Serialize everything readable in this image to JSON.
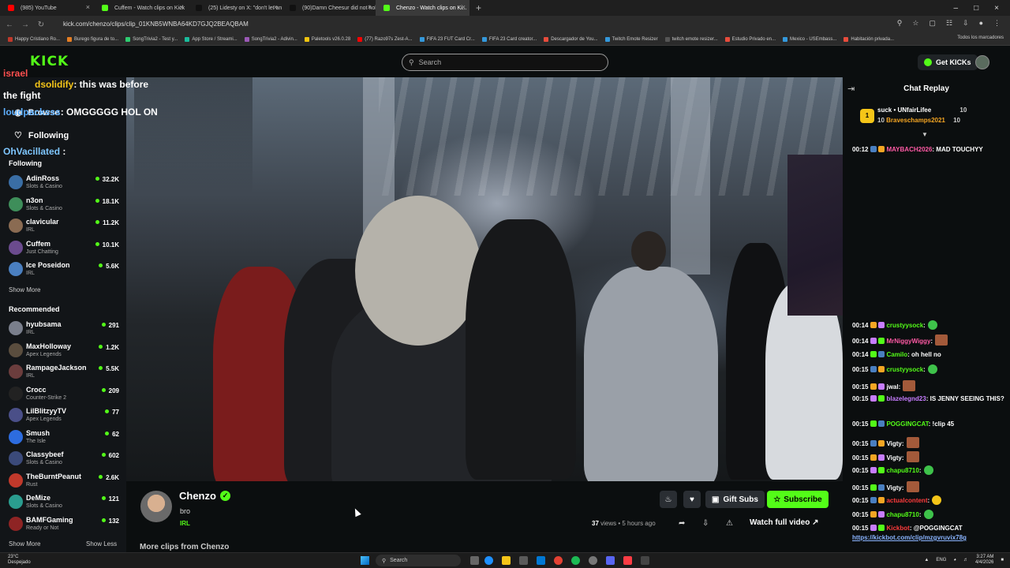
{
  "browser": {
    "tabs": [
      {
        "label": "(985) YouTube",
        "color": "#ff0000"
      },
      {
        "label": "Cuffem - Watch clips on Kick",
        "color": "#53fc18"
      },
      {
        "label": "(25) Lidesty on X: \"don't let any...",
        "color": "#111111"
      },
      {
        "label": "(90)Damn Cheesur did not hold...",
        "color": "#111111"
      },
      {
        "label": "Chenzo - Watch clips on Ki...",
        "color": "#53fc18",
        "active": true
      }
    ],
    "url": "kick.com/chenzo/clips/clip_01KNB5WNBA64KD7GJQ2BEAQBAM",
    "bookmarks": [
      "Happy Cristiano Ro...",
      "Burego figura de to...",
      "SongTrivia2 - Test y...",
      "App Store / Streami...",
      "SongTrivia2 - Adivin...",
      "Paletools v26.0.28",
      "(77) Razo97s Zest-A...",
      "FIFA 23 FUT Card Cr...",
      "FIFA 23 Card creator...",
      "Descargador de You...",
      "Twitch Emote Resizer",
      "twitch emote resizer...",
      "Estudio Privado en...",
      "Mexico - USEmbass...",
      "Habitación privada..."
    ],
    "bookmarks_right": "Todos los marcadores"
  },
  "site": {
    "logo": "KICK",
    "search_placeholder": "Search",
    "get_kicks": "Get KICKs"
  },
  "overlay_chat": [
    {
      "user": "israel",
      "text": ""
    },
    {
      "user": "dsolidify",
      "text": ": this was before"
    },
    {
      "user": "",
      "text": "the fight"
    },
    {
      "user": "loudpacksss",
      "text": ": OMGGGGG HOL ON"
    },
    {
      "user": "OhVacillated",
      "text": " :"
    }
  ],
  "sidebar": {
    "nav": [
      {
        "label": "Browse",
        "icon": "browse-icon"
      },
      {
        "label": "Following",
        "icon": "heart-icon"
      }
    ],
    "following_title": "Following",
    "following": [
      {
        "name": "AdinRoss",
        "category": "Slots & Casino",
        "viewers": "32.2K",
        "color": "#3a6ea5"
      },
      {
        "name": "n3on",
        "category": "Slots & Casino",
        "viewers": "18.1K",
        "color": "#3e8e5a"
      },
      {
        "name": "clavicular",
        "category": "IRL",
        "viewers": "11.2K",
        "color": "#8a6b52"
      },
      {
        "name": "Cuffem",
        "category": "Just Chatting",
        "viewers": "10.1K",
        "color": "#6b4b8e"
      },
      {
        "name": "Ice Poseidon",
        "category": "IRL",
        "viewers": "5.6K",
        "color": "#4a7fc0"
      }
    ],
    "show_more": "Show More",
    "recommended_title": "Recommended",
    "recommended": [
      {
        "name": "hyubsama",
        "category": "IRL",
        "viewers": "291",
        "color": "#7a7f8c"
      },
      {
        "name": "MaxHolloway",
        "category": "Apex Legends",
        "viewers": "1.2K",
        "color": "#5a4d3e"
      },
      {
        "name": "RampageJackson",
        "category": "IRL",
        "viewers": "5.5K",
        "color": "#6b3d3d"
      },
      {
        "name": "Crocc",
        "category": "Counter-Strike 2",
        "viewers": "209",
        "color": "#222222"
      },
      {
        "name": "LilBlitzyyTV",
        "category": "Apex Legends",
        "viewers": "77",
        "color": "#4a4f88"
      },
      {
        "name": "Smush",
        "category": "The Isle",
        "viewers": "62",
        "color": "#2d6cdf"
      },
      {
        "name": "Classybeef",
        "category": "Slots & Casino",
        "viewers": "602",
        "color": "#3b4a7a"
      },
      {
        "name": "TheBurntPeanut",
        "category": "Rust",
        "viewers": "2.6K",
        "color": "#c0392b"
      },
      {
        "name": "DeMize",
        "category": "Slots & Casino",
        "viewers": "121",
        "color": "#2a9d8f"
      },
      {
        "name": "BAMFGaming",
        "category": "Ready or Not",
        "viewers": "132",
        "color": "#8e2424"
      }
    ],
    "show_more_2": "Show More",
    "show_less": "Show Less"
  },
  "channel": {
    "name": "Chenzo",
    "title": "bro",
    "category": "IRL",
    "gift_subs": "Gift Subs",
    "subscribe": "Subscribe",
    "views": "37",
    "views_label": " views",
    "age": " • 5 hours ago",
    "watch_full": "Watch full video",
    "more_clips": "More clips from Chenzo"
  },
  "chat": {
    "header": "Chat Replay",
    "pinned": {
      "rank": "1",
      "user1": "suck",
      "user2": "UNfairLifee",
      "count1": "10",
      "count2": "10",
      "user3": "Braveschamps2021",
      "count3": "10"
    },
    "messages": [
      {
        "ts": "00:12",
        "user": "MAYBACH2026",
        "color": "#ff5aa5",
        "text": ": MAD TOUCHYY",
        "emote": ""
      },
      {
        "ts": "00:14",
        "user": "crustyysock",
        "color": "#53fc18",
        "text": ":",
        "emote": "g"
      },
      {
        "ts": "00:14",
        "user": "MrNiggyWiggy",
        "color": "#ff5aa5",
        "text": ":",
        "emote": "r"
      },
      {
        "ts": "00:14",
        "user": "Camilo",
        "color": "#53fc18",
        "text": ": oh hell no",
        "emote": ""
      },
      {
        "ts": "00:15",
        "user": "crustyysock",
        "color": "#53fc18",
        "text": ":",
        "emote": "g"
      },
      {
        "ts": "00:15",
        "user": "jwal",
        "color": "#ffffff",
        "text": ":",
        "emote": "r"
      },
      {
        "ts": "00:15",
        "user": "blazelegnd23",
        "color": "#c77dff",
        "text": ": IS JENNY SEEING THIS?",
        "emote": ""
      },
      {
        "ts": "00:15",
        "user": "POGGINGCAT",
        "color": "#53fc18",
        "text": ": !clip 45",
        "emote": ""
      },
      {
        "ts": "00:15",
        "user": "Vigty",
        "color": "#ffffff",
        "text": ":",
        "emote": "r"
      },
      {
        "ts": "00:15",
        "user": "Vigty",
        "color": "#ffffff",
        "text": ":",
        "emote": "r"
      },
      {
        "ts": "00:15",
        "user": "chapu8710",
        "color": "#53fc18",
        "text": ":",
        "emote": "g"
      },
      {
        "ts": "00:15",
        "user": "Vigty",
        "color": "#ffffff",
        "text": ":",
        "emote": "r"
      },
      {
        "ts": "00:15",
        "user": "actualcontent",
        "color": "#ff3b3b",
        "text": ":",
        "emote": "y"
      },
      {
        "ts": "00:15",
        "user": "chapu8710",
        "color": "#53fc18",
        "text": ":",
        "emote": "g"
      },
      {
        "ts": "00:15",
        "user": "Kickbot",
        "color": "#ff3b3b",
        "text": ": @POGGINGCAT",
        "emote": "",
        "link": "https://kickbot.com/clip/mzgvruvix78g"
      }
    ]
  },
  "taskbar": {
    "temp": "23°C",
    "weather": "Despejado",
    "search": "Search",
    "lang": "ENG",
    "time": "3:27 AM",
    "date": "4/4/2026"
  }
}
